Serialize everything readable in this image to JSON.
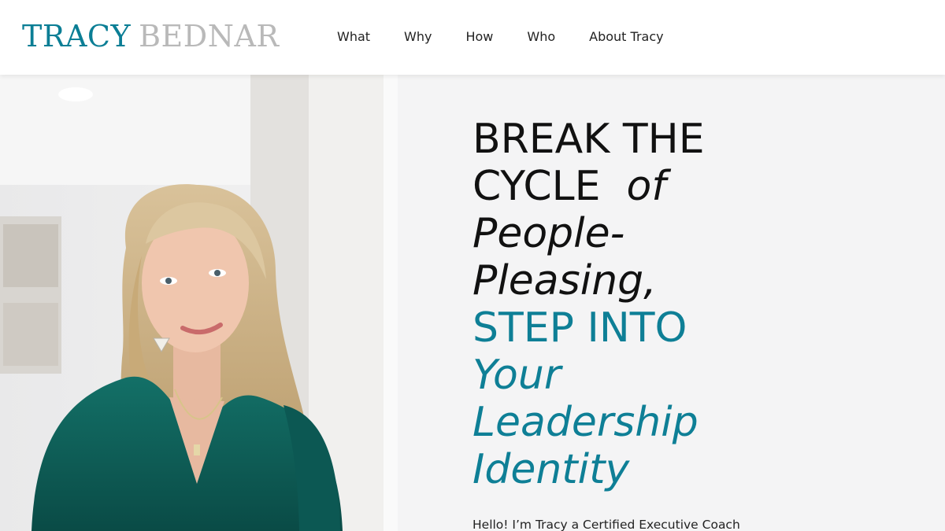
{
  "header": {
    "logo_first": "TRACY",
    "logo_last": "BEDNAR",
    "nav": [
      "What",
      "Why",
      "How",
      "Who",
      "About Tracy"
    ]
  },
  "hero": {
    "headline": {
      "line1": "BREAK THE",
      "line2_a": "CYCLE",
      "line2_b": "of",
      "line3": "People-",
      "line4": "Pleasing,",
      "line5": "STEP INTO",
      "line6": "Your",
      "line7": "Leadership",
      "line8": "Identity"
    },
    "intro": "Hello!  I’m Tracy a Certified Executive Coach"
  },
  "colors": {
    "brand_teal": "#0e7f96",
    "logo_gray": "#b9b9b9",
    "hero_bg": "#f4f4f5",
    "blouse_teal": "#0f5f5a"
  }
}
